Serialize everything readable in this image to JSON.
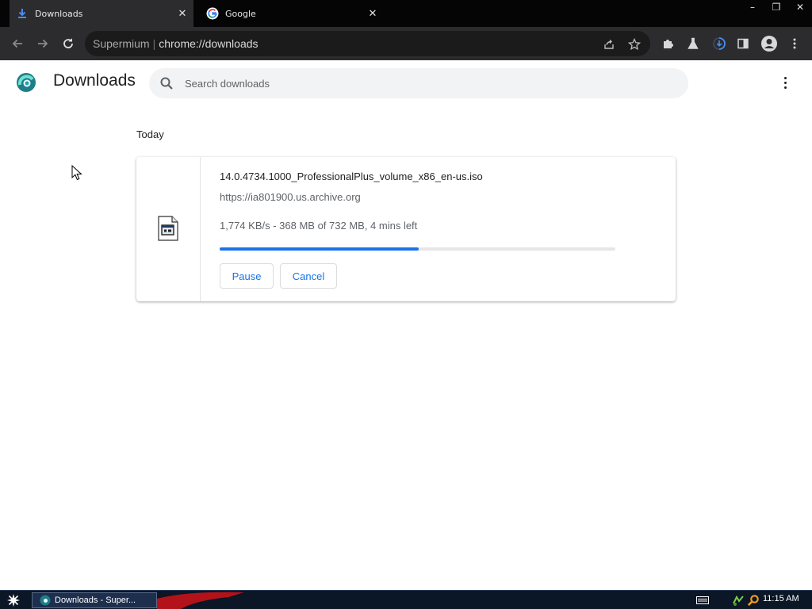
{
  "browser": {
    "tabs": [
      {
        "label": "Downloads",
        "active": true,
        "icon": "download-icon"
      },
      {
        "label": "Google",
        "active": false,
        "icon": "google-g-icon"
      }
    ],
    "omnibox": {
      "label": "Supermium",
      "url": "chrome://downloads"
    },
    "window_controls": {
      "minimize": "–",
      "restore": "❐",
      "close": "✕"
    }
  },
  "downloads_page": {
    "title": "Downloads",
    "search_placeholder": "Search downloads",
    "date_header": "Today",
    "item": {
      "file_name": "14.0.4734.1000_ProfessionalPlus_volume_x86_en-us.iso",
      "source_url": "https://ia801900.us.archive.org",
      "progress_text": "1,774 KB/s - 368 MB of 732 MB, 4 mins left",
      "progress_fraction": 0.503,
      "pause_label": "Pause",
      "cancel_label": "Cancel"
    }
  },
  "taskbar": {
    "window_item": "Downloads - Super...",
    "clock": "11:15 AM"
  },
  "colors": {
    "accent_blue": "#1a73e8",
    "tabstrip_bg": "#050505",
    "toolbar_bg": "#2c2c2e",
    "taskbar_bg": "#0b1626"
  }
}
